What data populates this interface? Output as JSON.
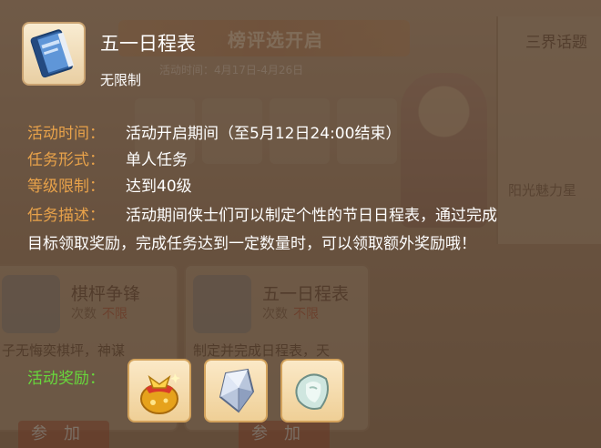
{
  "background": {
    "banner_text": "榜评选开启",
    "date_text": "活动时间：4月17日-4月26日",
    "right_title": "三界话题",
    "right_text": "阳光魅力星",
    "cards": [
      {
        "title": "棋枰争锋",
        "count_label": "次数",
        "count_value": "不限",
        "desc": "子无悔奕棋坪，神谋",
        "join": "参加"
      },
      {
        "title": "五一日程表",
        "count_label": "次数",
        "count_value": "不限",
        "desc": "制定并完成日程表，天",
        "join": "参加"
      }
    ]
  },
  "tooltip": {
    "icon": "blue-book-icon",
    "title": "五一日程表",
    "subtitle": "无限制",
    "rows": [
      {
        "label": "活动时间：",
        "value": "活动开启期间（至5月12日24:00结束）"
      },
      {
        "label": "任务形式：",
        "value": "单人任务"
      },
      {
        "label": "等级限制：",
        "value": "达到40级"
      },
      {
        "label": "任务描述：",
        "value": "活动期间侠士们可以制定个性的节日日程表，通过完成"
      }
    ],
    "desc_line2": "目标领取奖励，完成任务达到一定数量时，可以领取额外奖励哦！",
    "reward_label": "活动奖励：",
    "rewards": [
      {
        "icon": "gold-treasure-bag-icon"
      },
      {
        "icon": "crystal-shard-icon"
      },
      {
        "icon": "jade-stone-icon"
      }
    ]
  },
  "colors": {
    "label": "#e8a24a",
    "value": "#ffffff",
    "reward_label": "#68d83c"
  }
}
